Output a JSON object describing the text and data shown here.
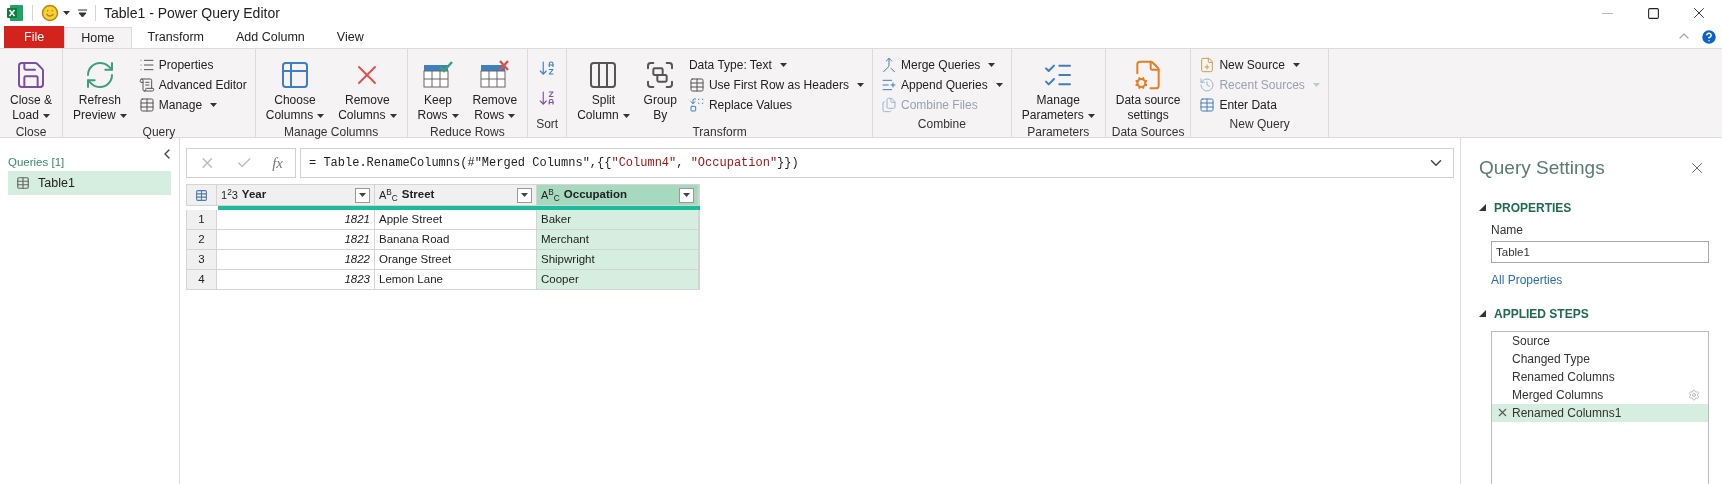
{
  "window": {
    "title": "Table1 - Power Query Editor"
  },
  "ribbon_tabs": [
    {
      "label": "File",
      "kind": "file",
      "selected": false
    },
    {
      "label": "Home",
      "kind": "tab",
      "selected": true
    },
    {
      "label": "Transform",
      "kind": "tab",
      "selected": false
    },
    {
      "label": "Add Column",
      "kind": "tab",
      "selected": false
    },
    {
      "label": "View",
      "kind": "tab",
      "selected": false
    }
  ],
  "ribbon_groups": [
    {
      "label": "Close",
      "items": [
        {
          "kind": "large",
          "lines": [
            "Close &",
            "Load"
          ],
          "dropdown": true,
          "disabled": false
        }
      ]
    },
    {
      "label": "Query",
      "items": [
        {
          "kind": "large",
          "lines": [
            "Refresh",
            "Preview"
          ],
          "dropdown": true,
          "disabled": false
        },
        {
          "kind": "small",
          "lines": [
            "Properties"
          ],
          "dropdown": false,
          "disabled": false
        },
        {
          "kind": "small",
          "lines": [
            "Advanced Editor"
          ],
          "dropdown": false,
          "disabled": false
        },
        {
          "kind": "small",
          "lines": [
            "Manage"
          ],
          "dropdown": true,
          "disabled": false
        }
      ]
    },
    {
      "label": "Manage Columns",
      "items": [
        {
          "kind": "large",
          "lines": [
            "Choose",
            "Columns"
          ],
          "dropdown": true,
          "disabled": false
        },
        {
          "kind": "large",
          "lines": [
            "Remove",
            "Columns"
          ],
          "dropdown": true,
          "disabled": false
        }
      ]
    },
    {
      "label": "Reduce Rows",
      "items": [
        {
          "kind": "large",
          "lines": [
            "Keep",
            "Rows"
          ],
          "dropdown": true,
          "disabled": false
        },
        {
          "kind": "large",
          "lines": [
            "Remove",
            "Rows"
          ],
          "dropdown": true,
          "disabled": false
        }
      ]
    },
    {
      "label": "Sort",
      "items": [
        {
          "kind": "icon"
        },
        {
          "kind": "icon"
        }
      ]
    },
    {
      "label": "Transform",
      "items": [
        {
          "kind": "large",
          "lines": [
            "Split",
            "Column"
          ],
          "dropdown": true,
          "disabled": false
        },
        {
          "kind": "large",
          "lines": [
            "Group",
            "By"
          ],
          "dropdown": false,
          "disabled": false
        },
        {
          "kind": "small",
          "lines": [
            "Data Type: Text"
          ],
          "dropdown": true,
          "disabled": false
        },
        {
          "kind": "small",
          "lines": [
            "Use First Row as Headers"
          ],
          "dropdown": true,
          "disabled": false
        },
        {
          "kind": "small",
          "lines": [
            "Replace Values"
          ],
          "dropdown": false,
          "disabled": false
        }
      ]
    },
    {
      "label": "Combine",
      "items": [
        {
          "kind": "small",
          "lines": [
            "Merge Queries"
          ],
          "dropdown": true,
          "disabled": false
        },
        {
          "kind": "small",
          "lines": [
            "Append Queries"
          ],
          "dropdown": true,
          "disabled": false
        },
        {
          "kind": "small",
          "lines": [
            "Combine Files"
          ],
          "dropdown": false,
          "disabled": true
        }
      ]
    },
    {
      "label": "Parameters",
      "items": [
        {
          "kind": "large",
          "lines": [
            "Manage",
            "Parameters"
          ],
          "dropdown": true,
          "disabled": false
        }
      ]
    },
    {
      "label": "Data Sources",
      "items": [
        {
          "kind": "large",
          "lines": [
            "Data source",
            "settings"
          ],
          "dropdown": false,
          "disabled": false
        }
      ]
    },
    {
      "label": "New Query",
      "items": [
        {
          "kind": "small",
          "lines": [
            "New Source"
          ],
          "dropdown": true,
          "disabled": false
        },
        {
          "kind": "small",
          "lines": [
            "Recent Sources"
          ],
          "dropdown": true,
          "disabled": true
        },
        {
          "kind": "small",
          "lines": [
            "Enter Data"
          ],
          "dropdown": false,
          "disabled": false
        }
      ]
    }
  ],
  "queries_pane": {
    "title": "Queries [1]",
    "items": [
      {
        "label": "Table1",
        "selected": true
      }
    ]
  },
  "formula_bar": {
    "function_label": "fx",
    "segments": [
      {
        "kind": "code",
        "text": "= Table.RenameColumns(#\"Merged Columns\",{{"
      },
      {
        "kind": "string",
        "text": "\"Column4\""
      },
      {
        "kind": "code",
        "text": ", "
      },
      {
        "kind": "string",
        "text": "\"Occupation\""
      },
      {
        "kind": "code",
        "text": "}})"
      }
    ]
  },
  "table": {
    "columns": [
      {
        "type": "1$^{2}$3",
        "name": "Year",
        "kind": "number",
        "selected": false
      },
      {
        "type": "A$^{B}$$_{C}$",
        "name": "Street",
        "kind": "text",
        "selected": false
      },
      {
        "type": "A$^{B}$$_{C}$",
        "name": "Occupation",
        "kind": "text",
        "selected": true
      }
    ],
    "rows": [
      {
        "index": "1",
        "cells": [
          "1821",
          "Apple Street",
          "Baker"
        ]
      },
      {
        "index": "2",
        "cells": [
          "1821",
          "Banana Road",
          "Merchant"
        ]
      },
      {
        "index": "3",
        "cells": [
          "1822",
          "Orange Street",
          "Shipwright"
        ]
      },
      {
        "index": "4",
        "cells": [
          "1823",
          "Lemon Lane",
          "Cooper"
        ]
      }
    ]
  },
  "query_settings": {
    "title": "Query Settings",
    "properties": {
      "heading": "PROPERTIES",
      "expanded": true,
      "name_label": "Name",
      "name_value": "Table1",
      "link": "All Properties"
    },
    "applied_steps": {
      "heading": "APPLIED STEPS",
      "expanded": true,
      "steps": [
        {
          "label": "Source",
          "selected": false,
          "settings": false
        },
        {
          "label": "Changed Type",
          "selected": false,
          "settings": false
        },
        {
          "label": "Renamed Columns",
          "selected": false,
          "settings": false
        },
        {
          "label": "Merged Columns",
          "selected": false,
          "settings": true
        },
        {
          "label": "Renamed Columns1",
          "selected": true,
          "settings": false
        }
      ]
    }
  }
}
